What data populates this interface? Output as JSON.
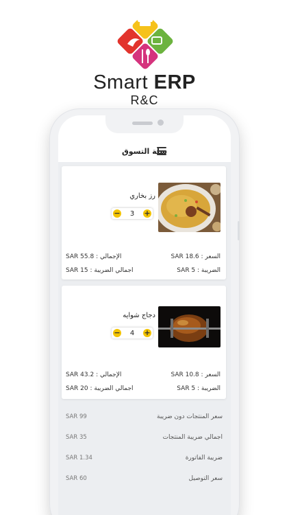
{
  "brand": {
    "name_part1": "Smart",
    "name_part2": "ERP",
    "subtitle": "R&C"
  },
  "header": {
    "title": "سلة التسوق",
    "menu_icon": "hamburger-menu-icon"
  },
  "cart": {
    "items": [
      {
        "name": "رز بخاري",
        "quantity": "3",
        "price": "السعر : SAR 18.6",
        "tax": "الضريبة : SAR 5",
        "total": "الإجمالي : SAR 55.8",
        "total_tax": "اجمالي الضريبة : SAR 15"
      },
      {
        "name": "دجاج شوايه",
        "quantity": "4",
        "price": "السعر : SAR 10.8",
        "tax": "الضريبة : SAR 5",
        "total": "الإجمالي : SAR 43.2",
        "total_tax": "اجمالي الضريبة : SAR 20"
      }
    ],
    "stepper": {
      "minus": "−",
      "plus": "+"
    }
  },
  "summary": [
    {
      "label": "سعر المنتجات دون ضريبة",
      "value": "SAR 99"
    },
    {
      "label": "اجمالي ضريبة المنتجات",
      "value": "SAR 35"
    },
    {
      "label": "ضريبة الفاتورة",
      "value": "SAR 1.34"
    },
    {
      "label": "سعر التوصيل",
      "value": "SAR 60"
    }
  ],
  "colors": {
    "accent": "#f3c300",
    "logo_red": "#e2342d",
    "logo_green": "#6cb33f",
    "logo_yellow": "#f6c21b",
    "logo_pink": "#d5337d"
  }
}
